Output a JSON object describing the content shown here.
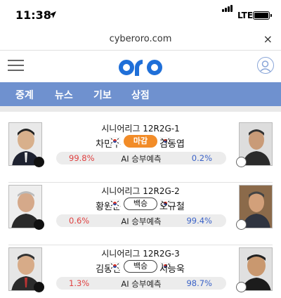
{
  "status_bar": {
    "time": "11:38",
    "network": "LTE"
  },
  "browser": {
    "url": "cyberoro.com",
    "close_label": "×"
  },
  "header": {
    "logo_text": "oro",
    "brand_color": "#1f6fd8"
  },
  "nav": {
    "tabs": [
      "중계",
      "뉴스",
      "기보",
      "상점"
    ],
    "bg_color": "#6f91cf"
  },
  "matches": [
    {
      "league": "시니어리그 12R2G-1",
      "left_player": "차민수",
      "right_player": "김동엽",
      "status": "마감",
      "status_style": "orange",
      "left_pct": "99.8%",
      "center_label": "AI 승부예측",
      "right_pct": "0.2%"
    },
    {
      "league": "시니어리그 12R2G-2",
      "left_player": "황원준",
      "right_player": "오규철",
      "status": "백승",
      "status_style": "outline",
      "left_pct": "0.6%",
      "center_label": "AI 승부예측",
      "right_pct": "99.4%"
    },
    {
      "league": "시니어리그 12R2G-3",
      "left_player": "김동면",
      "right_player": "서능욱",
      "status": "백승",
      "status_style": "outline",
      "left_pct": "1.3%",
      "center_label": "AI 승부예측",
      "right_pct": "98.7%"
    }
  ]
}
